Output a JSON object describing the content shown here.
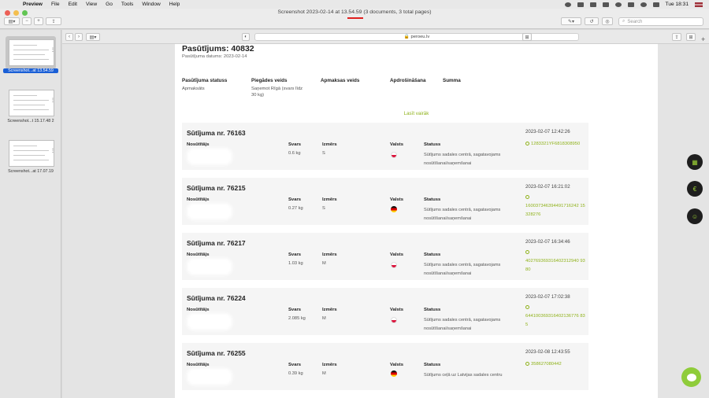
{
  "menubar": {
    "app": "Preview",
    "items": [
      "File",
      "Edit",
      "View",
      "Go",
      "Tools",
      "Window",
      "Help"
    ],
    "clock": "Tue 18:31"
  },
  "window": {
    "title_prefix": "Screenshot 2023-02-14 at ",
    "title_time": "13.54.59",
    "title_suffix": " (3 documents, 3 total pages)",
    "search_placeholder": "Search"
  },
  "sidebar": {
    "items": [
      {
        "label": "Screenshot...at 13.54.59",
        "selected": true
      },
      {
        "label": "Screenshot...t 15.17.48 2",
        "selected": false
      },
      {
        "label": "Screenshot...at 17.07.19",
        "selected": false
      }
    ]
  },
  "browser": {
    "url": "🔒 peroeu.lv"
  },
  "order": {
    "title": "Pasūtījums: 40832",
    "date_label": "Pasūtījuma datums: 2023-02-14",
    "headers": [
      "Pasūtījuma statuss",
      "Piegādes veids",
      "Apmaksas veids",
      "Apdrošināšana",
      "Summa"
    ],
    "status_value": "Apmaksāts",
    "delivery_value_1": "Saņemot Rīgā (svars līdz",
    "delivery_value_2": "30 kg)",
    "more_link": "Lasīt vairāk"
  },
  "shipment_labels": {
    "sender": "Nosūtītājs",
    "weight": "Svars",
    "size": "Izmērs",
    "country": "Valsts",
    "status": "Statuss"
  },
  "shipments": [
    {
      "title": "Sūtījuma nr. 76163",
      "date": "2023-02-07 12:42:26",
      "weight": "0.6 kg",
      "size": "S",
      "country_flag": "poland",
      "status_1": "Sūtījums sadales centrā, sagatavojams",
      "status_2": "nosūtīšanai/saņemšanai",
      "tracking": "1283321YF6818308950"
    },
    {
      "title": "Sūtījuma nr. 76215",
      "date": "2023-02-07 16:21:02",
      "weight": "0.27 kg",
      "size": "S",
      "country_flag": "germany",
      "status_1": "Sūtījums sadales centrā, sagatavojams",
      "status_2": "nosūtīšanai/saņemšanai",
      "tracking": "160037346394491716242 15328276"
    },
    {
      "title": "Sūtījuma nr. 76217",
      "date": "2023-02-07 16:34:46",
      "weight": "1.03 kg",
      "size": "M",
      "country_flag": "poland",
      "status_1": "Sūtījums sadales centrā, sagatavojams",
      "status_2": "nosūtīšanai/saņemšanai",
      "tracking": "402769369316402312940 9380"
    },
    {
      "title": "Sūtījuma nr. 76224",
      "date": "2023-02-07 17:02:38",
      "weight": "2.085 kg",
      "size": "M",
      "country_flag": "poland",
      "status_1": "Sūtījums sadales centrā, sagatavojams",
      "status_2": "nosūtīšanai/saņemšanai",
      "tracking": "644100369316402136776 835"
    },
    {
      "title": "Sūtījuma nr. 76255",
      "date": "2023-02-08 12:43:55",
      "weight": "0.39 kg",
      "size": "M",
      "country_flag": "germany",
      "status_1": "Sūtījums ceļā uz Latvijas sadales centru",
      "status_2": "",
      "tracking": "358627080442"
    }
  ],
  "colors": {
    "accent_green": "#8fb21a",
    "selection_blue": "#1a5fd6",
    "fab_dark": "#1e1e1e"
  }
}
